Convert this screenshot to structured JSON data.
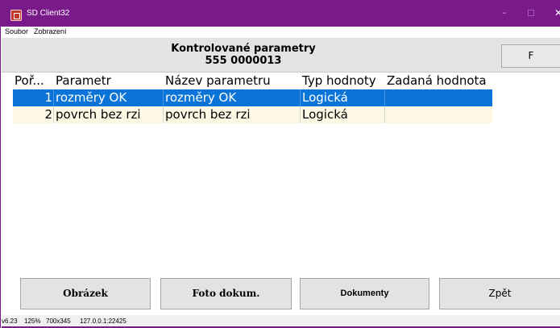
{
  "window": {
    "title": "SD Client32",
    "controls": {
      "minimize": "–",
      "maximize": "□",
      "close": "✕"
    }
  },
  "menu": {
    "items": [
      "Soubor",
      "Zobrazení"
    ]
  },
  "header": {
    "title": "Kontrolované parametry",
    "subtitle": "555 0000013",
    "f_button": "F"
  },
  "table": {
    "columns": [
      "Poř...",
      "Parametr",
      "Název parametru",
      "Typ hodnoty",
      "Zadaná hodnota"
    ],
    "rows": [
      {
        "order": "1",
        "param": "rozměry OK",
        "name": "rozměry OK",
        "type": "Logická",
        "value": "",
        "selected": true
      },
      {
        "order": "2",
        "param": "povrch bez rzi",
        "name": "povrch bez rzi",
        "type": "Logická",
        "value": "",
        "selected": false
      }
    ]
  },
  "buttons": {
    "obrazek": "Obrázek",
    "foto": "Foto dokum.",
    "dokumenty": "Dokumenty",
    "zpet": "Zpět"
  },
  "status": {
    "version": "v6.23",
    "zoom": "125%",
    "resolution": "700x345",
    "address": "127.0.0.1:22425"
  },
  "colors": {
    "titlebar": "#7a1a8a",
    "selected_row": "#0a74d9",
    "row_background": "#fdf8e4",
    "header_background": "#e3e3e3"
  }
}
